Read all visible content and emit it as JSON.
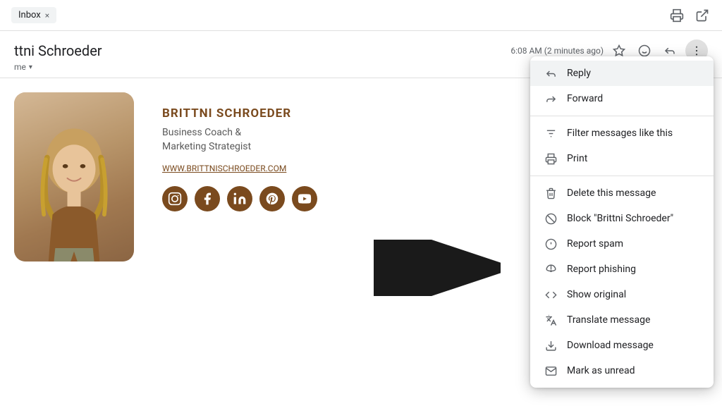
{
  "topbar": {
    "inbox_label": "Inbox",
    "close_label": "×",
    "print_icon": "🖨",
    "popout_icon": "⤢"
  },
  "email": {
    "sender_name": "ttni Schroeder",
    "to_label": "me",
    "time": "6:08 AM (2 minutes ago)",
    "star_icon": "☆",
    "emoji_icon": "☺",
    "reply_icon": "↩",
    "more_icon": "⋮"
  },
  "signature": {
    "name": "BRITTNI SCHROEDER",
    "title_line1": "Business Coach &",
    "title_line2": "Marketing Strategist",
    "website": "WWW.BRITTNISCHROEDER.COM",
    "social_icons": [
      "instagram",
      "facebook",
      "linkedin",
      "pinterest",
      "youtube"
    ]
  },
  "menu": {
    "items": [
      {
        "id": "reply",
        "label": "Reply",
        "icon": "reply"
      },
      {
        "id": "forward",
        "label": "Forward",
        "icon": "forward"
      },
      {
        "id": "filter",
        "label": "Filter messages like this",
        "icon": "filter"
      },
      {
        "id": "print",
        "label": "Print",
        "icon": "print"
      },
      {
        "id": "delete",
        "label": "Delete this message",
        "icon": "delete"
      },
      {
        "id": "block",
        "label": "Block \"Brittni Schroeder\"",
        "icon": "block"
      },
      {
        "id": "spam",
        "label": "Report spam",
        "icon": "spam"
      },
      {
        "id": "phishing",
        "label": "Report phishing",
        "icon": "phishing"
      },
      {
        "id": "original",
        "label": "Show original",
        "icon": "code"
      },
      {
        "id": "translate",
        "label": "Translate message",
        "icon": "translate"
      },
      {
        "id": "download",
        "label": "Download message",
        "icon": "download"
      },
      {
        "id": "unread",
        "label": "Mark as unread",
        "icon": "unread"
      }
    ]
  }
}
